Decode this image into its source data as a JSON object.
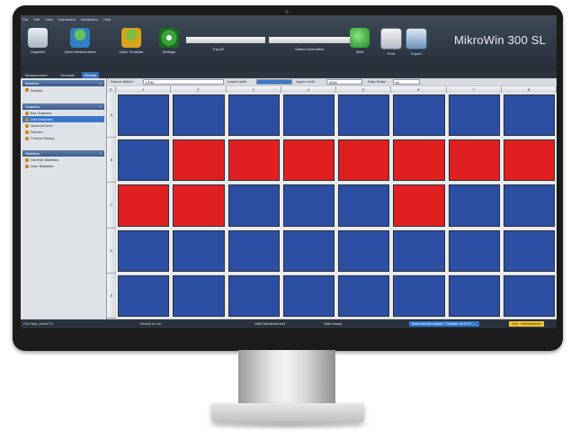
{
  "menu": [
    "File",
    "Edit",
    "View",
    "Instrument",
    "Installation",
    "Help"
  ],
  "ribbon": {
    "buttons": [
      {
        "label": "Organize",
        "icon": "organize-icon"
      },
      {
        "label": "Open Measurement",
        "icon": "open-measurement-icon"
      },
      {
        "label": "Open Template",
        "icon": "open-template-icon"
      },
      {
        "label": "Settings",
        "icon": "settings-icon"
      },
      {
        "label": "Start",
        "icon": "start-icon"
      },
      {
        "label": "Print",
        "icon": "print-icon"
      },
      {
        "label": "Export",
        "icon": "export-icon"
      }
    ],
    "tray_label": "Tray ID",
    "status_label": "Status information",
    "brand": "MikroWin 300 SL"
  },
  "tabs": [
    "Measurement",
    "Template",
    "Results"
  ],
  "active_tab": "Results",
  "sidebar": {
    "sections": [
      {
        "title": "Matrices",
        "items": [
          "Results"
        ]
      },
      {
        "title": "Graphics",
        "items": [
          "Bar Graphics",
          "Line Graphics",
          "QuenchCurve",
          "Spectra",
          "Control History"
        ]
      },
      {
        "title": "Statistics",
        "items": [
          "General Statistics",
          "User Statistics"
        ]
      }
    ],
    "selected": "Line Graphics"
  },
  "toolbar": {
    "source_label": "Source Matrix:",
    "source_value": "CPM",
    "lower_label": "Lower Limit:",
    "lower_value": "",
    "upper_label": "Upper Limit:",
    "upper_value": "4000",
    "scale_label": "Data Scale:",
    "scale_value": "lin."
  },
  "plate": {
    "corner": "R",
    "columns": [
      "1",
      "2",
      "3",
      "4",
      "5",
      "6",
      "7",
      "8"
    ],
    "rows": [
      "A",
      "B",
      "C",
      "D",
      "E"
    ],
    "wells": [
      [
        "blue",
        "blue",
        "blue",
        "blue",
        "blue",
        "blue",
        "blue",
        "blue"
      ],
      [
        "blue",
        "red",
        "red",
        "red",
        "red",
        "red",
        "red",
        "red"
      ],
      [
        "red",
        "red",
        "blue",
        "blue",
        "blue",
        "red",
        "blue",
        "blue"
      ],
      [
        "blue",
        "blue",
        "blue",
        "blue",
        "blue",
        "blue",
        "blue",
        "blue"
      ],
      [
        "blue",
        "blue",
        "blue",
        "blue",
        "blue",
        "blue",
        "blue",
        "blue"
      ]
    ],
    "colors": {
      "blue": "#2c4fa3",
      "red": "#e02020"
    }
  },
  "statusbar": {
    "help": "For Help, press F1",
    "state": "Ready to run",
    "measurement": "Valid Measurement",
    "assay": "Valid Assay",
    "instrument": "Berthold Microplate / Twinkle LB 970 / ...",
    "mode": "<M> <Embedded>"
  }
}
